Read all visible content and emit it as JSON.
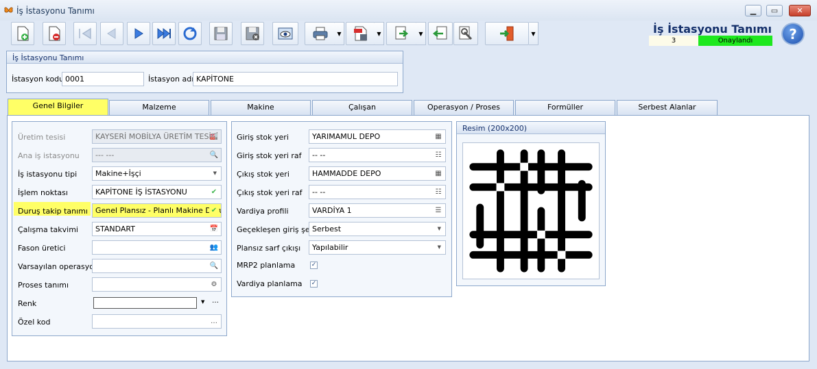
{
  "window": {
    "title": "İş İstasyonu Tanımı"
  },
  "header": {
    "title": "İş İstasyonu Tanımı",
    "number": "3",
    "status": "Onaylandı",
    "status_color": "#1ee81e"
  },
  "toolbar": {
    "icons": [
      "new-document-icon",
      "delete-document-icon",
      "first-record-icon",
      "previous-record-icon",
      "next-record-icon",
      "last-record-icon",
      "refresh-icon",
      "save-icon",
      "save-close-icon",
      "preview-icon",
      "print-icon",
      "pdf-export-icon",
      "export-icon",
      "import-icon",
      "settings-icon",
      "exit-icon",
      "help-icon"
    ]
  },
  "station": {
    "group_title": "İş İstasyonu Tanımı",
    "code_label": "İstasyon kodu",
    "code_value": "0001",
    "name_label": "İstasyon adı",
    "name_value": "KAPİTONE"
  },
  "tabs": [
    "Genel Bilgiler",
    "Malzeme",
    "Makine",
    "Çalışan",
    "Operasyon / Proses",
    "Formüller",
    "Serbest Alanlar"
  ],
  "left_fields": [
    {
      "label": "Üretim tesisi",
      "value": "KAYSERİ MOBİLYA ÜRETİM TESİSİ",
      "disabled": true
    },
    {
      "label": "Ana iş istasyonu",
      "value": "--- ---",
      "disabled": true
    },
    {
      "label": "İş istasyonu tipi",
      "value": "Makine+İşçi"
    },
    {
      "label": "İşlem noktası",
      "value": "KAPİTONE İŞ İSTASYONU"
    },
    {
      "label": "Duruş takip tanımı",
      "value": "Genel Plansız - Planlı Makine Duruş"
    },
    {
      "label": "Çalışma takvimi",
      "value": "STANDART"
    },
    {
      "label": "Fason üretici",
      "value": ""
    },
    {
      "label": "Varsayılan operasyon",
      "value": ""
    },
    {
      "label": "Proses tanımı",
      "value": ""
    },
    {
      "label": "Renk",
      "value": ""
    },
    {
      "label": "Özel kod",
      "value": ""
    }
  ],
  "mid_fields": [
    {
      "label": "Giriş stok yeri",
      "value": "YARIMAMUL DEPO"
    },
    {
      "label": "Giriş stok yeri raf",
      "value": "-- --"
    },
    {
      "label": "Çıkış stok yeri",
      "value": "HAMMADDE DEPO"
    },
    {
      "label": "Çıkış stok yeri raf",
      "value": "-- --"
    },
    {
      "label": "Vardiya profili",
      "value": "VARDİYA 1"
    },
    {
      "label": "Geçekleşen giriş şekli",
      "value": "Serbest"
    },
    {
      "label": "Plansız sarf çıkışı",
      "value": "Yapılabilir"
    },
    {
      "label": "MRP2 planlama",
      "value": "✓"
    },
    {
      "label": "Vardiya planlama",
      "value": "✓"
    }
  ],
  "image_group": {
    "title": "Resim (200x200)"
  },
  "highlight_color": "#ffff66"
}
